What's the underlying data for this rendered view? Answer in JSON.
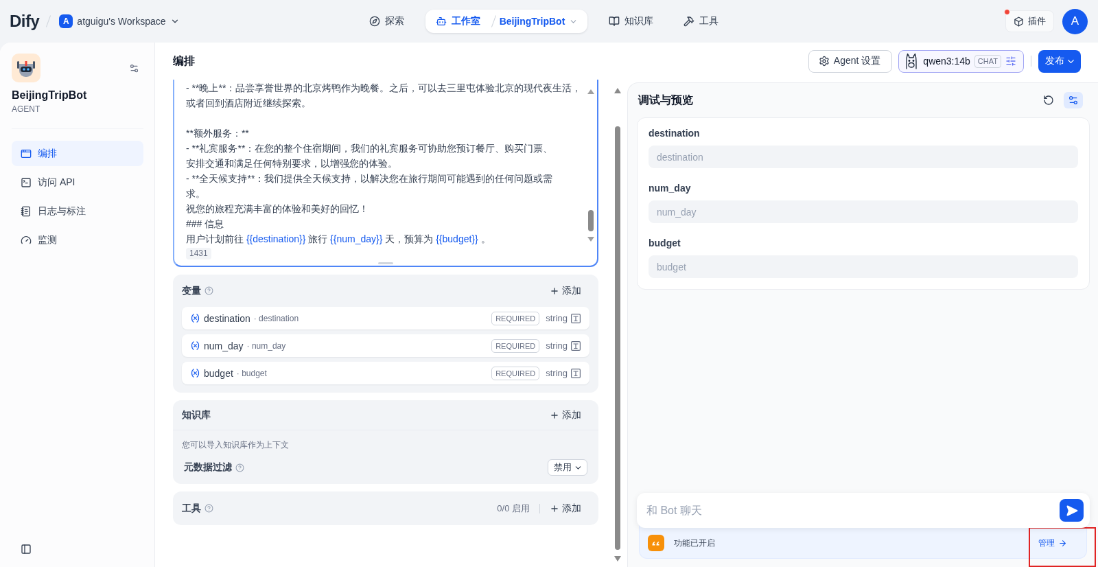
{
  "top_bar": {
    "logo": "Dify",
    "workspace": {
      "initial": "A",
      "name": "atguigu's Workspace"
    },
    "nav": [
      {
        "kind": "explore",
        "label": "探索",
        "selected": false
      },
      {
        "kind": "studio",
        "label": "工作室",
        "app": "BeijingTripBot",
        "selected": true
      },
      {
        "kind": "knowledge",
        "label": "知识库",
        "selected": false
      },
      {
        "kind": "tools",
        "label": "工具",
        "selected": false
      }
    ],
    "plugins": {
      "label": "插件",
      "has_notification": true
    },
    "user": {
      "initial": "A"
    }
  },
  "sidebar": {
    "app": {
      "name": "BeijingTripBot",
      "type": "AGENT"
    },
    "items": [
      {
        "kind": "orchestrate",
        "label": "编排",
        "selected": true
      },
      {
        "kind": "api",
        "label": "访问 API",
        "selected": false
      },
      {
        "kind": "logs",
        "label": "日志与标注",
        "selected": false
      },
      {
        "kind": "monitor",
        "label": "监测",
        "selected": false
      }
    ]
  },
  "header": {
    "title": "编排",
    "agent_settings": "Agent 设置",
    "model": {
      "name": "qwen3:14b",
      "mode": "CHAT"
    },
    "publish": "发布"
  },
  "prompt": {
    "paragraphs": [
      {
        "lines": [
          [
            {
              "kind": "text",
              "text": "- **晚上**：品尝享誉世界的北京烤鸭作为晚餐。之后，可以去三里屯体验北京的现代夜生活，"
            }
          ],
          [
            {
              "kind": "text",
              "text": "或者回到酒店附近继续探索。"
            }
          ]
        ]
      },
      {
        "lines": [
          [
            {
              "kind": "text",
              "text": "**额外服务：**"
            }
          ],
          [
            {
              "kind": "text",
              "text": "- **礼宾服务**：在您的整个住宿期间，我们的礼宾服务可协助您预订餐厅、购买门票、"
            }
          ],
          [
            {
              "kind": "text",
              "text": "安排交通和满足任何特别要求，以增强您的体验。"
            }
          ],
          [
            {
              "kind": "text",
              "text": "- **全天候支持**：我们提供全天候支持，以解决您在旅行期间可能遇到的任何问题或需"
            }
          ],
          [
            {
              "kind": "text",
              "text": "求。"
            }
          ],
          [
            {
              "kind": "text",
              "text": "祝您的旅程充满丰富的体验和美好的回忆！"
            }
          ],
          [
            {
              "kind": "text",
              "text": "### 信息"
            }
          ],
          [
            {
              "kind": "text",
              "text": "用户计划前往 "
            },
            {
              "kind": "variable",
              "text": "{{destination}}"
            },
            {
              "kind": "text",
              "text": " 旅行 "
            },
            {
              "kind": "variable",
              "text": "{{num_day}}"
            },
            {
              "kind": "text",
              "text": " 天，预算为 "
            },
            {
              "kind": "variable",
              "text": "{{budget}}"
            },
            {
              "kind": "text",
              "text": " 。"
            }
          ]
        ]
      }
    ],
    "char_count": "1431"
  },
  "variables": {
    "title": "变量",
    "add": "添加",
    "items": [
      {
        "name": "destination",
        "alias": "· destination",
        "badge": "REQUIRED",
        "type": "string"
      },
      {
        "name": "num_day",
        "alias": "· num_day",
        "badge": "REQUIRED",
        "type": "string"
      },
      {
        "name": "budget",
        "alias": "· budget",
        "badge": "REQUIRED",
        "type": "string"
      }
    ]
  },
  "knowledge": {
    "title": "知识库",
    "add": "添加",
    "hint": "您可以导入知识库作为上下文",
    "metadata_filter": {
      "label": "元数据过滤",
      "value": "禁用"
    }
  },
  "tools": {
    "title": "工具",
    "status": "0/0 启用",
    "add": "添加"
  },
  "debug": {
    "title": "调试与预览",
    "actions": [
      {
        "kind": "restart",
        "selected": false
      },
      {
        "kind": "settings",
        "selected": true
      }
    ],
    "inputs": [
      {
        "label": "destination",
        "placeholder": "destination"
      },
      {
        "label": "num_day",
        "placeholder": "num_day"
      },
      {
        "label": "budget",
        "placeholder": "budget"
      }
    ],
    "chat": {
      "placeholder": "和 Bot 聊天"
    },
    "features": {
      "status": "功能已开启",
      "manage": "管理",
      "highlighted": true
    }
  }
}
